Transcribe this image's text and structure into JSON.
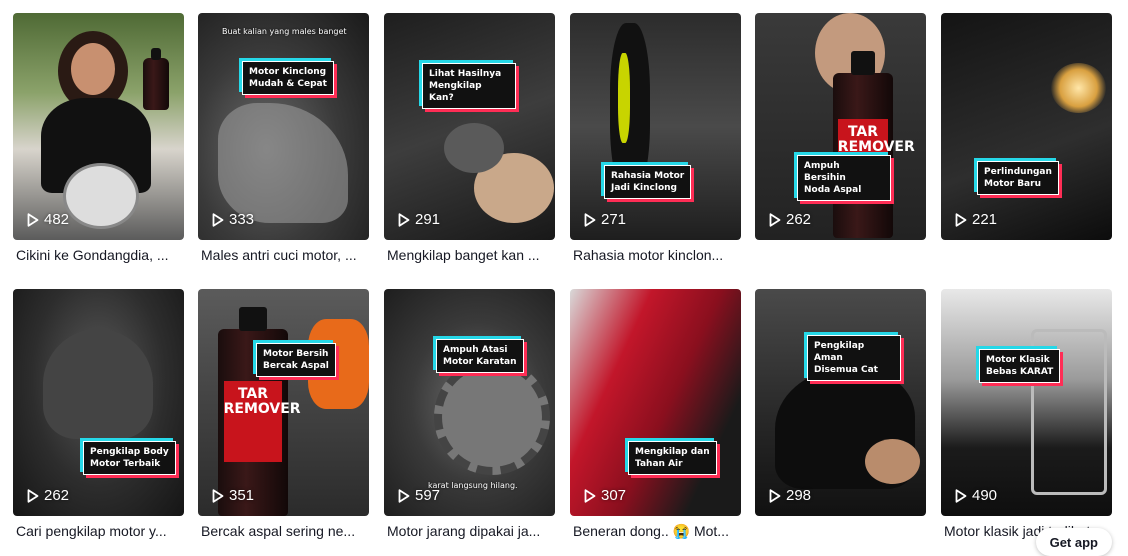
{
  "videos": [
    {
      "plays": "482",
      "title": "Cikini ke Gondangdia, ...",
      "overlay": "",
      "caption": ""
    },
    {
      "plays": "333",
      "title": "Males antri cuci motor, ...",
      "overlay": "Motor Kinclong\nMudah & Cepat",
      "caption": "Buat kalian yang males banget"
    },
    {
      "plays": "291",
      "title": "Mengkilap banget kan ...",
      "overlay": "Lihat Hasilnya\nMengkilap Kan?",
      "caption": ""
    },
    {
      "plays": "271",
      "title": "Rahasia motor kinclon...",
      "overlay": "Rahasia Motor\nJadi Kinclong",
      "caption": ""
    },
    {
      "plays": "262",
      "title": "",
      "overlay": "Ampuh Bersihin\nNoda Aspal",
      "caption": ""
    },
    {
      "plays": "221",
      "title": "",
      "overlay": "Perlindungan\nMotor Baru",
      "caption": ""
    },
    {
      "plays": "262",
      "title": "Cari pengkilap motor y...",
      "overlay": "Pengkilap Body\nMotor Terbaik",
      "caption": ""
    },
    {
      "plays": "351",
      "title": "Bercak aspal sering ne...",
      "overlay": "Motor Bersih\nBercak Aspal",
      "caption": ""
    },
    {
      "plays": "597",
      "title": "Motor jarang dipakai ja...",
      "overlay": "Ampuh Atasi\nMotor Karatan",
      "caption": "karat langsung hilang."
    },
    {
      "plays": "307",
      "title": "Beneran dong.. 😭 Mot...",
      "overlay": "Mengkilap dan\nTahan Air",
      "caption": ""
    },
    {
      "plays": "298",
      "title": "",
      "overlay": "Pengkilap Aman\nDisemua Cat",
      "caption": ""
    },
    {
      "plays": "490",
      "title": "Motor klasik jadi terlihat...",
      "overlay": "Motor Klasik\nBebas KARAT",
      "caption": ""
    }
  ],
  "product": {
    "label_line1": "TAR",
    "label_line2": "REMOVER"
  },
  "get_app_label": "Get app",
  "icons": {
    "play": "play-icon"
  }
}
